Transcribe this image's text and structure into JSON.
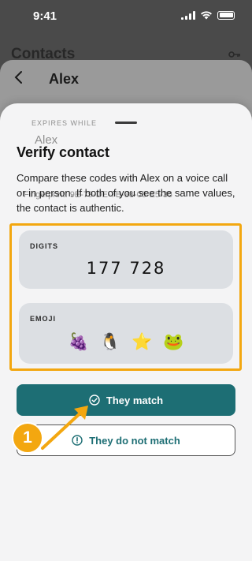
{
  "status_bar": {
    "time": "9:41"
  },
  "background": {
    "title": "Contacts",
    "contact_name": "Alex",
    "ghost_label": "EXPIRES WHILE",
    "ghost_name": "Alex",
    "ghost_fingerprint": "Fingerprint: 9E-79-DE-7B-38-06-E5-36"
  },
  "sheet": {
    "title": "Verify contact",
    "description": "Compare these codes with Alex on a voice call or in person. If both of you see the same values, the contact is authentic.",
    "digits_label": "DIGITS",
    "digits_value": "177 728",
    "emoji_label": "EMOJI",
    "emojis": [
      "🍇",
      "🐧",
      "⭐",
      "🐸"
    ],
    "match_button": "They match",
    "no_match_button": "They do not match"
  },
  "annotation": {
    "step": "1"
  },
  "colors": {
    "accent": "#1d6e74",
    "highlight": "#f3a710"
  }
}
